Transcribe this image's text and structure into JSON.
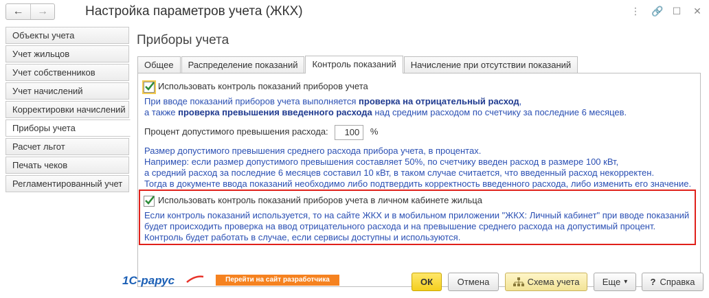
{
  "window": {
    "title": "Настройка параметров учета (ЖКХ)",
    "back_icon": "←",
    "forward_icon": "→",
    "tools": [
      "⋮",
      "🔗",
      "☐",
      "✕"
    ]
  },
  "sidebar": {
    "items": [
      {
        "label": "Объекты учета"
      },
      {
        "label": "Учет жильцов"
      },
      {
        "label": "Учет собственников"
      },
      {
        "label": "Учет начислений"
      },
      {
        "label": "Корректировки начислений"
      },
      {
        "label": "Приборы учета"
      },
      {
        "label": "Расчет льгот"
      },
      {
        "label": "Печать чеков"
      },
      {
        "label": "Регламентированный учет"
      }
    ],
    "active_index": 5
  },
  "main": {
    "title": "Приборы учета",
    "tabs": [
      {
        "label": "Общее"
      },
      {
        "label": "Распределение показаний"
      },
      {
        "label": "Контроль показаний"
      },
      {
        "label": "Начисление при отсутствии показаний"
      }
    ],
    "active_tab": 2,
    "control": {
      "checkbox_label": "Использовать контроль показаний приборов учета",
      "checked": true,
      "info1_part1": "При вводе показаний приборов учета выполняется ",
      "info1_bold1": "проверка на отрицательный расход",
      "info1_part2": ",",
      "info2_part1": "а также ",
      "info2_bold": "проверка превышения введенного расхода",
      "info2_part2": " над средним расходом по счетчику за последние 6 месяцев.",
      "percent_label": "Процент допустимого превышения расхода:",
      "percent_value": "100",
      "percent_unit": "%",
      "desc_lines": [
        "Размер допустимого превышения среднего расхода прибора учета, в процентах.",
        "Например: если  размер допустимого превышения составляет 50%,  по счетчику введен расход в размере 100 кВт,",
        "а средний расход за последние 6 месяцев составил 10 кВт, в таком случае считается, что введенный расход некорректен.",
        "Тогда в документе ввода показаний необходимо либо подтвердить корректность введенного расхода, либо изменить его значение."
      ]
    },
    "cabinet": {
      "checkbox_label": "Использовать контроль показаний приборов учета в личном кабинете жильца",
      "checked": true,
      "desc_lines": [
        "Если контроль показаний используется, то на сайте ЖКХ и в мобильном приложении \"ЖКХ: Личный кабинет\" при вводе показаний",
        "будет происходить проверка на ввод отрицательного расхода и на превышение среднего расхода на допустимый процент.",
        "Контроль будет работать в случае, если сервисы доступны и используются."
      ]
    }
  },
  "footer": {
    "logo_text": "1С-рарус",
    "dev_link": "Перейти на сайт разработчика",
    "ok": "ОК",
    "cancel": "Отмена",
    "scheme": "Схема учета",
    "more": "Еще",
    "more_arrow": "▾",
    "help": "Справка",
    "help_icon": "?"
  },
  "colors": {
    "accent_blue": "#2a4fb3",
    "highlight_red": "#e0201a",
    "ok_yellow": "#f4cf1e",
    "link_orange": "#f58220"
  }
}
